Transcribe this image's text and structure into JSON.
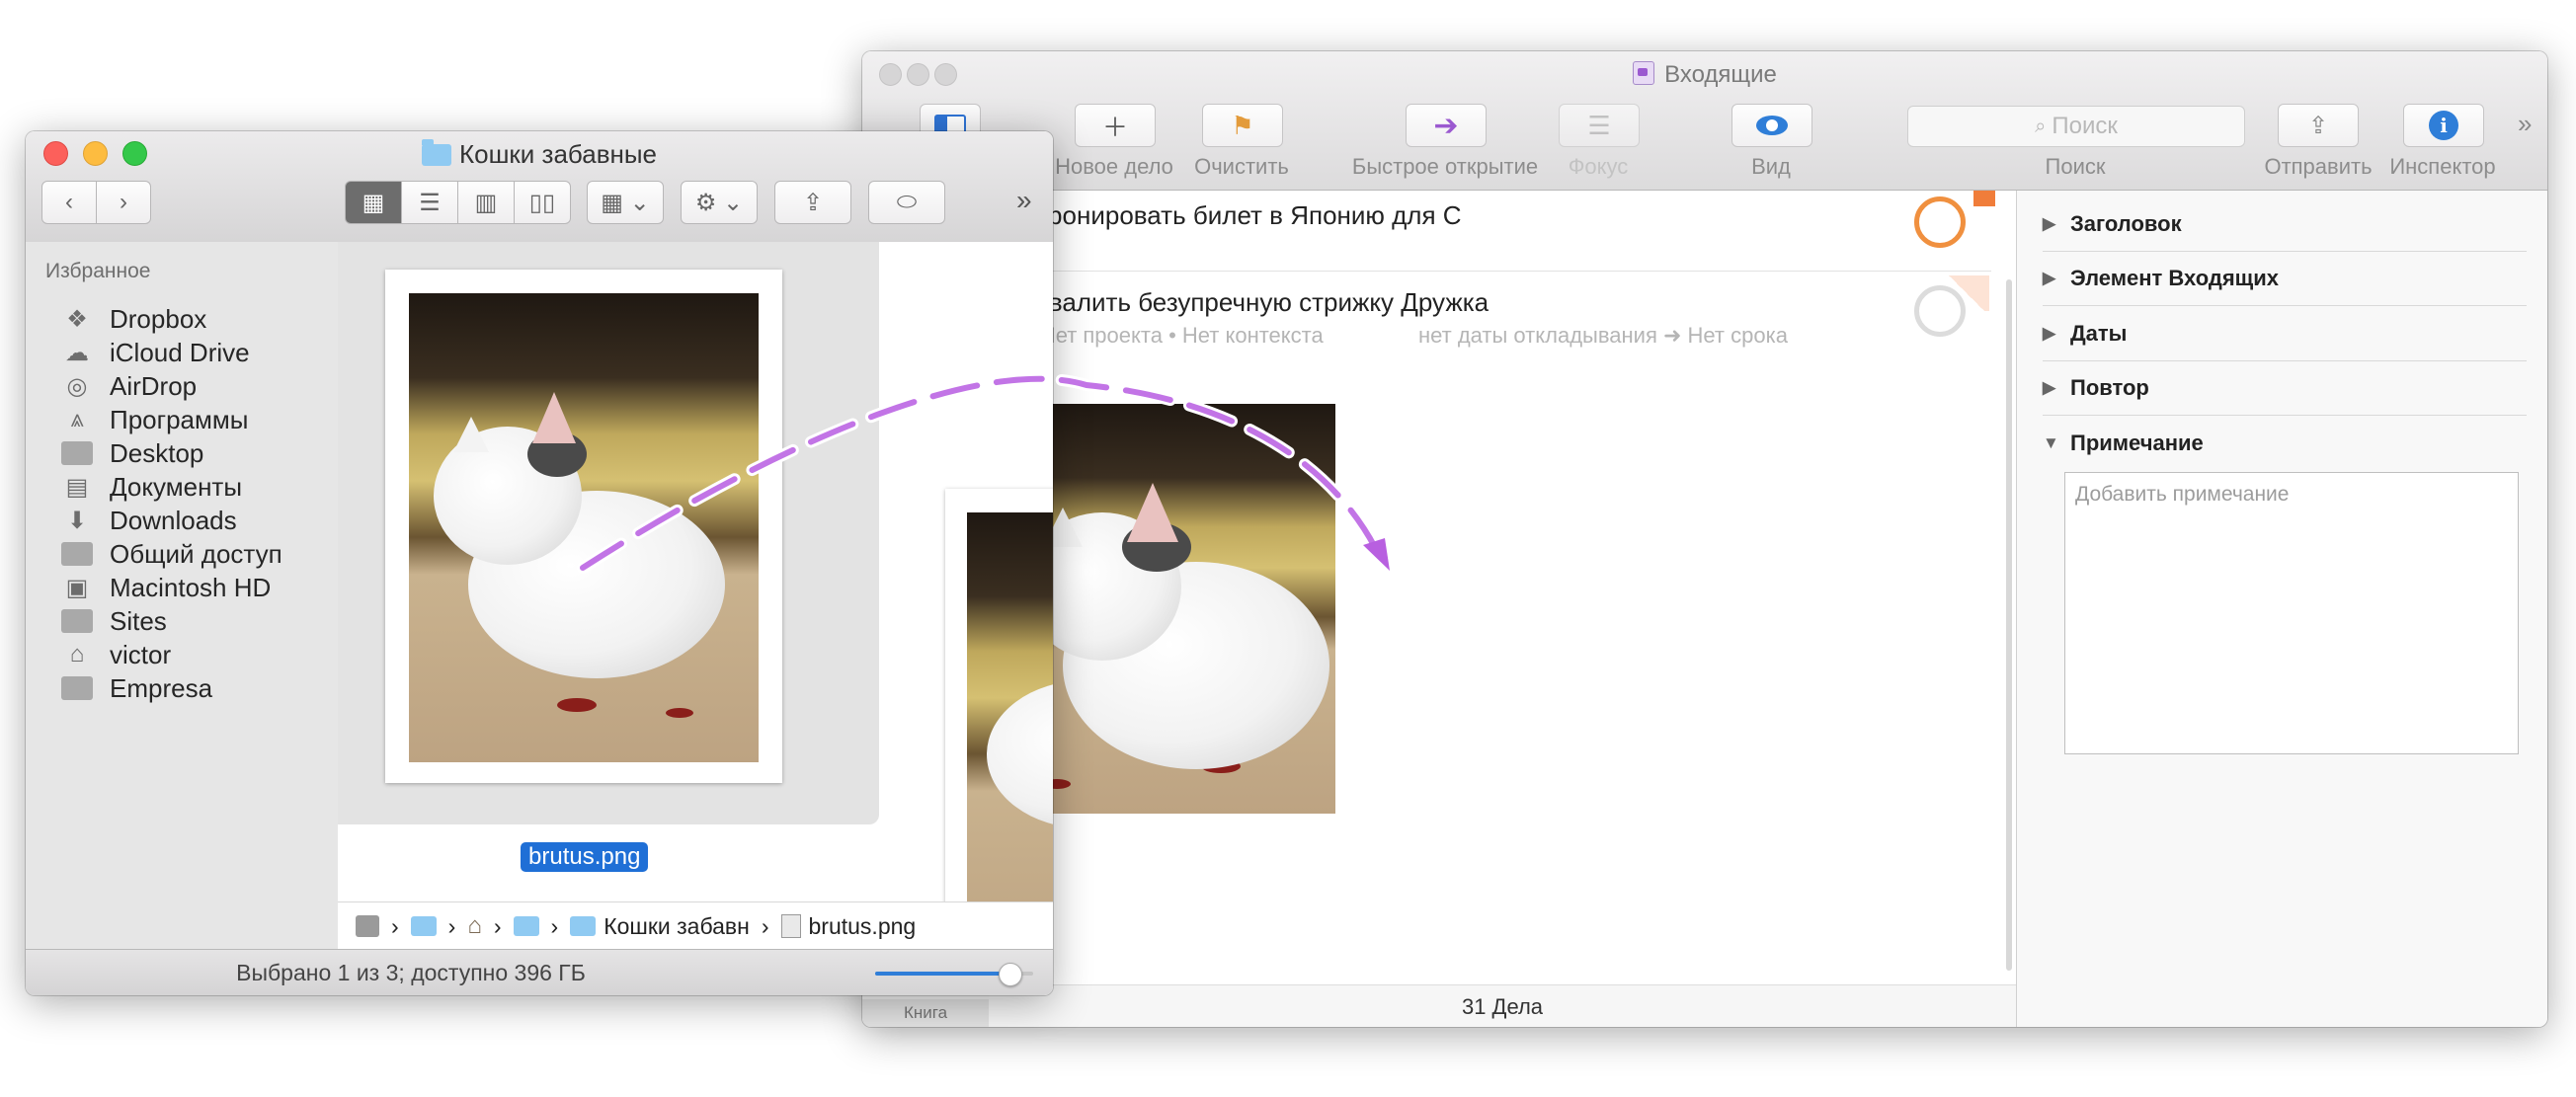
{
  "omnifocus": {
    "window_title": "Входящие",
    "toolbar": {
      "new_action_label": "Новое дело",
      "clean_up_label": "Очистить",
      "quick_open_label": "Быстрое открытие",
      "focus_label": "Фокус",
      "view_label": "Вид",
      "search_placeholder": "Поиск",
      "search_label": "Поиск",
      "share_label": "Отправить",
      "inspector_label": "Инспектор"
    },
    "tasks": [
      {
        "title": "Забронировать билет в Японию для С"
      },
      {
        "title": "Похвалить безупречную стрижку Дружка",
        "meta_project_context": "• Нет проекта • Нет контекста",
        "meta_defer_due": "нет даты откладывания ➜ Нет срока"
      }
    ],
    "inspector": {
      "sections": [
        "Заголовок",
        "Элемент Входящих",
        "Даты",
        "Повтор",
        "Примечание"
      ],
      "note_placeholder": "Добавить примечание"
    },
    "status": "31 Дела",
    "sidebar_stub_label": "Книга"
  },
  "finder": {
    "window_title": "Кошки забавные",
    "sidebar": {
      "header": "Избранное",
      "items": [
        {
          "label": "Dropbox",
          "icon": "dropbox-icon"
        },
        {
          "label": "iCloud Drive",
          "icon": "cloud-icon"
        },
        {
          "label": "AirDrop",
          "icon": "airdrop-icon"
        },
        {
          "label": "Программы",
          "icon": "applications-icon"
        },
        {
          "label": "Desktop",
          "icon": "desktop-icon"
        },
        {
          "label": "Документы",
          "icon": "documents-icon"
        },
        {
          "label": "Downloads",
          "icon": "downloads-icon"
        },
        {
          "label": "Общий доступ",
          "icon": "folder-icon"
        },
        {
          "label": "Macintosh HD",
          "icon": "disk-icon"
        },
        {
          "label": "Sites",
          "icon": "folder-icon"
        },
        {
          "label": "victor",
          "icon": "home-icon"
        },
        {
          "label": "Empresa",
          "icon": "folder-icon"
        }
      ]
    },
    "selected_file": "brutus.png",
    "path_bar": {
      "folder": "Кошки забавн",
      "file": "brutus.png"
    },
    "status": "Выбрано 1 из 3; доступно 396 ГБ",
    "icon_size_slider": 0.85
  },
  "colors": {
    "selection_blue": "#1f6fd6",
    "drag_arrow": "#c274e6",
    "task_circle_orange": "#f0903f"
  }
}
